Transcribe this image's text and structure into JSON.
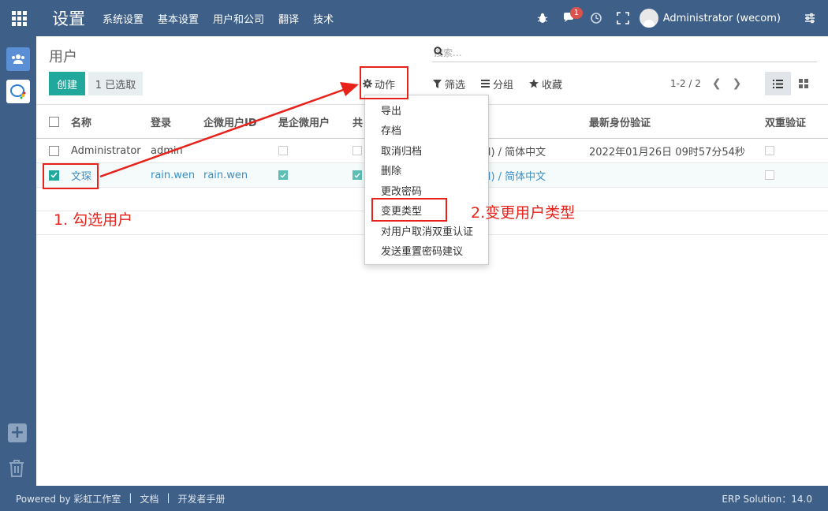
{
  "topbar": {
    "app_title": "设置",
    "menu": [
      "系统设置",
      "基本设置",
      "用户和公司",
      "翻译",
      "技术"
    ],
    "chat_badge": "1",
    "user_name": "Administrator (wecom)"
  },
  "control_panel": {
    "title": "用户",
    "search_placeholder": "搜索...",
    "create_label": "创建",
    "selected_label": "1 已选取",
    "action_label": "动作",
    "filter_label": "筛选",
    "group_label": "分组",
    "favorite_label": "收藏",
    "pager": "1-2 / 2"
  },
  "table": {
    "columns": [
      "名称",
      "登录",
      "企微用户ID",
      "是企微用户",
      "共",
      "最新身份验证",
      "双重验证"
    ],
    "rows": [
      {
        "name": "Administrator",
        "login": "admin",
        "wecom_id": "",
        "is_wecom": false,
        "shared": false,
        "lang": "fied) / 简体中文",
        "last_auth": "2022年01月26日 09时57分54秒",
        "twofa": false,
        "selected": false
      },
      {
        "name": "文琛",
        "login": "rain.wen",
        "wecom_id": "rain.wen",
        "is_wecom": true,
        "shared": true,
        "lang": "fied) / 简体中文",
        "last_auth": "",
        "twofa": false,
        "selected": true
      }
    ]
  },
  "action_menu": [
    "导出",
    "存档",
    "取消归档",
    "删除",
    "更改密码",
    "变更类型",
    "对用户取消双重认证",
    "发送重置密码建议"
  ],
  "annotations": {
    "step1": "1. 勾选用户",
    "step2": "2.变更用户类型"
  },
  "footer": {
    "powered": "Powered by 彩虹工作室",
    "sep": "|",
    "docs": "文档",
    "dev": "开发者手册",
    "version": "ERP Solution：14.0"
  },
  "colors": {
    "nav": "#3e5f87",
    "primary": "#21a89c",
    "annotation": "#e8211b"
  }
}
